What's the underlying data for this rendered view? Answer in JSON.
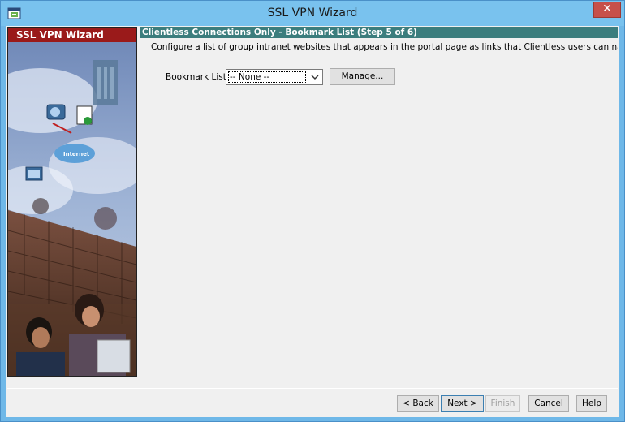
{
  "window": {
    "title": "SSL VPN Wizard",
    "close_label": "✕"
  },
  "banner": {
    "title": "SSL VPN Wizard",
    "cloud_label": "Internet"
  },
  "step": {
    "header": "Clientless Connections Only - Bookmark List  (Step 5 of 6)",
    "description": "Configure a list of group intranet websites that appears in the portal page as links that Clientless users can navigate to."
  },
  "bookmark": {
    "label": "Bookmark List:",
    "selected": "-- None --",
    "manage_label": "Manage..."
  },
  "footer": {
    "back_pre": "< ",
    "back_key": "B",
    "back_post": "ack",
    "next_key": "N",
    "next_post": "ext >",
    "finish_label": "Finish",
    "cancel_key": "C",
    "cancel_post": "ancel",
    "help_key": "H",
    "help_post": "elp"
  },
  "colors": {
    "titlebar": "#79c2ee",
    "close": "#c7504a",
    "banner_title": "#9a1a1a",
    "step_header": "#3b7d7d"
  }
}
